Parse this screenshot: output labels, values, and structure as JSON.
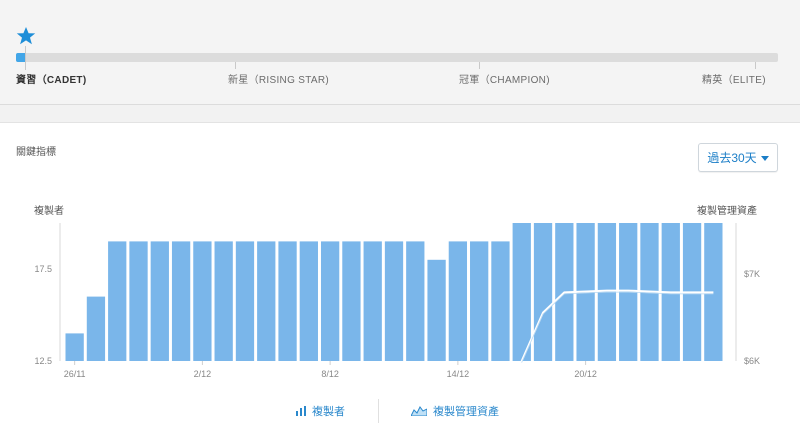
{
  "progress": {
    "fraction": 0.012,
    "levels": [
      {
        "label": "資習（CADET)",
        "current": true
      },
      {
        "label": "新星（RISING STAR)",
        "current": false
      },
      {
        "label": "冠軍（CHAMPION)",
        "current": false
      },
      {
        "label": "精英（ELITE)",
        "current": false
      }
    ],
    "star_icon": "star-icon",
    "accent": "#42a6e8"
  },
  "metrics": {
    "title": "關鍵指標",
    "period": "過去30天",
    "legend": {
      "copiers": "複製者",
      "aum": "複製管理資產"
    }
  },
  "chart_data": {
    "type": "bar",
    "y_left_title": "複製者",
    "y_right_title": "複製管理資產",
    "x_tick_labels": [
      {
        "index": 0,
        "label": "26/11"
      },
      {
        "index": 6,
        "label": "2/12"
      },
      {
        "index": 12,
        "label": "8/12"
      },
      {
        "index": 18,
        "label": "14/12"
      },
      {
        "index": 24,
        "label": "20/12"
      }
    ],
    "y_left": {
      "ticks": [
        "17.5",
        "12.5"
      ],
      "min": 12.5,
      "max": 20.0
    },
    "y_right": {
      "ticks": [
        "$7K",
        "$6K"
      ],
      "min": 6000,
      "max": 7000
    },
    "series": [
      {
        "name": "複製者",
        "values": [
          14,
          16,
          19,
          19,
          19,
          19,
          19,
          19,
          19,
          19,
          19,
          19,
          19,
          19,
          19,
          19,
          19,
          18,
          19,
          19,
          19,
          20,
          20,
          20,
          20,
          20,
          20,
          20,
          20,
          20,
          20
        ],
        "color": "#7ab6ea"
      },
      {
        "name": "複製管理資產",
        "values": [
          null,
          null,
          null,
          null,
          null,
          null,
          null,
          null,
          null,
          null,
          null,
          null,
          null,
          null,
          null,
          null,
          null,
          null,
          null,
          null,
          null,
          6000,
          6550,
          6780,
          6790,
          6800,
          6800,
          6790,
          6780,
          6780,
          6780
        ],
        "color": "#ffffff"
      }
    ],
    "bar_color": "#7ab6ea",
    "line_color": "#ffffff",
    "grid": false,
    "legend_position": "bottom"
  }
}
